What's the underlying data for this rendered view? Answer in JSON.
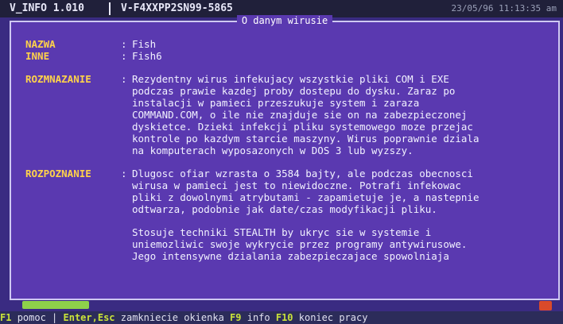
{
  "app": {
    "title": "V_INFO 1.010",
    "serial": "V-F4XXPP2SN99-5865",
    "clock": "23/05/96 11:13:35 am"
  },
  "window": {
    "title": "O danym wirusie"
  },
  "fields": {
    "nazwa": {
      "label": "NAZWA",
      "value": "Fish"
    },
    "inne": {
      "label": "INNE",
      "value": "Fish6"
    },
    "rozmnazanie": {
      "label": "ROZMNAZANIE",
      "value": "Rezydentny wirus infekujacy wszystkie pliki COM i EXE\npodczas prawie kazdej proby dostepu do dysku. Zaraz po\ninstalacji w pamieci przeszukuje system i zaraza\nCOMMAND.COM, o ile nie znajduje sie on na zabezpieczonej\ndyskietce. Dzieki infekcji pliku systemowego moze przejac\nkontrole po kazdym starcie maszyny. Wirus poprawnie dziala\nna komputerach wyposazonych w DOS 3 lub wyzszy."
    },
    "rozpoznanie": {
      "label": "ROZPOZNANIE",
      "value": "Dlugosc ofiar wzrasta o 3584 bajty, ale podczas obecnosci\nwirusa w pamieci jest to niewidoczne. Potrafi infekowac\npliki z dowolnymi atrybutami - zapamietuje je, a nastepnie\nodtwarza, podobnie jak date/czas modyfikacji pliku."
    },
    "stealth": {
      "value": "Stosuje techniki STEALTH by ukryc sie w systemie i\nuniemozliwic swoje wykrycie przez programy antywirusowe.\nJego intensywne dzialania zabezpieczajace spowolniaja"
    }
  },
  "statusbar": {
    "k1": "F1",
    "t1": "pomoc",
    "k2": "Enter,Esc",
    "t2": "zamkniecie okienka",
    "k3": "F9",
    "t3": "info",
    "k4": "F10",
    "t4": "koniec pracy"
  },
  "colors": {
    "window_bg": "#5a39b0",
    "label": "#ffd24a",
    "hotkey": "#c9e23a"
  }
}
